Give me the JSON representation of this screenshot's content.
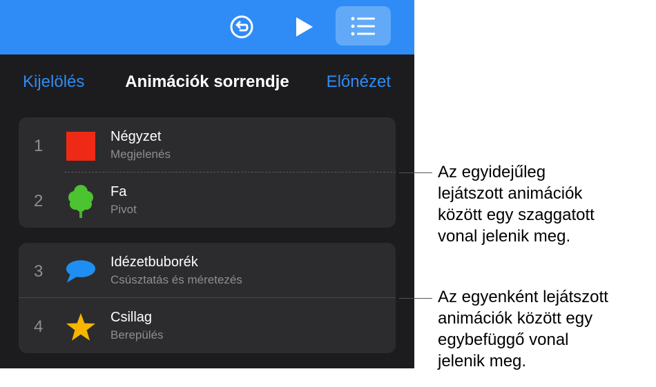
{
  "toolbar": {
    "icons": [
      "undo-icon",
      "play-icon",
      "list-icon"
    ],
    "accent": "#2f8cf6"
  },
  "nav": {
    "left_label": "Kijelölés",
    "title": "Animációk sorrendje",
    "right_label": "Előnézet"
  },
  "groups": [
    {
      "separator": "dashed",
      "items": [
        {
          "number": "1",
          "name": "Négyzet",
          "effect": "Megjelenés",
          "icon": "red-square-icon"
        },
        {
          "number": "2",
          "name": "Fa",
          "effect": "Pivot",
          "icon": "tree-icon"
        }
      ]
    },
    {
      "separator": "solid",
      "items": [
        {
          "number": "3",
          "name": "Idézetbuborék",
          "effect": "Csúsztatás és méretezés",
          "icon": "speech-bubble-icon"
        },
        {
          "number": "4",
          "name": "Csillag",
          "effect": "Berepülés",
          "icon": "star-icon"
        }
      ]
    }
  ],
  "callouts": [
    {
      "lines": [
        "Az egyidejűleg",
        "lejátszott animációk",
        "között egy szaggatott",
        "vonal jelenik meg."
      ]
    },
    {
      "lines": [
        "Az egyenként lejátszott",
        "animációk között egy",
        "egybefüggő vonal",
        "jelenik meg."
      ]
    }
  ]
}
